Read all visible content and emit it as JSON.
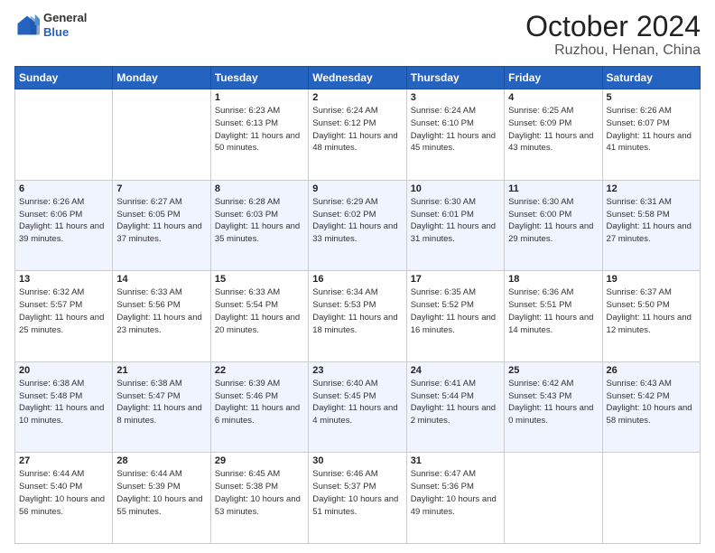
{
  "logo": {
    "general": "General",
    "blue": "Blue"
  },
  "title": "October 2024",
  "subtitle": "Ruzhou, Henan, China",
  "weekdays": [
    "Sunday",
    "Monday",
    "Tuesday",
    "Wednesday",
    "Thursday",
    "Friday",
    "Saturday"
  ],
  "weeks": [
    [
      {
        "day": "",
        "info": ""
      },
      {
        "day": "",
        "info": ""
      },
      {
        "day": "1",
        "info": "Sunrise: 6:23 AM\nSunset: 6:13 PM\nDaylight: 11 hours and 50 minutes."
      },
      {
        "day": "2",
        "info": "Sunrise: 6:24 AM\nSunset: 6:12 PM\nDaylight: 11 hours and 48 minutes."
      },
      {
        "day": "3",
        "info": "Sunrise: 6:24 AM\nSunset: 6:10 PM\nDaylight: 11 hours and 45 minutes."
      },
      {
        "day": "4",
        "info": "Sunrise: 6:25 AM\nSunset: 6:09 PM\nDaylight: 11 hours and 43 minutes."
      },
      {
        "day": "5",
        "info": "Sunrise: 6:26 AM\nSunset: 6:07 PM\nDaylight: 11 hours and 41 minutes."
      }
    ],
    [
      {
        "day": "6",
        "info": "Sunrise: 6:26 AM\nSunset: 6:06 PM\nDaylight: 11 hours and 39 minutes."
      },
      {
        "day": "7",
        "info": "Sunrise: 6:27 AM\nSunset: 6:05 PM\nDaylight: 11 hours and 37 minutes."
      },
      {
        "day": "8",
        "info": "Sunrise: 6:28 AM\nSunset: 6:03 PM\nDaylight: 11 hours and 35 minutes."
      },
      {
        "day": "9",
        "info": "Sunrise: 6:29 AM\nSunset: 6:02 PM\nDaylight: 11 hours and 33 minutes."
      },
      {
        "day": "10",
        "info": "Sunrise: 6:30 AM\nSunset: 6:01 PM\nDaylight: 11 hours and 31 minutes."
      },
      {
        "day": "11",
        "info": "Sunrise: 6:30 AM\nSunset: 6:00 PM\nDaylight: 11 hours and 29 minutes."
      },
      {
        "day": "12",
        "info": "Sunrise: 6:31 AM\nSunset: 5:58 PM\nDaylight: 11 hours and 27 minutes."
      }
    ],
    [
      {
        "day": "13",
        "info": "Sunrise: 6:32 AM\nSunset: 5:57 PM\nDaylight: 11 hours and 25 minutes."
      },
      {
        "day": "14",
        "info": "Sunrise: 6:33 AM\nSunset: 5:56 PM\nDaylight: 11 hours and 23 minutes."
      },
      {
        "day": "15",
        "info": "Sunrise: 6:33 AM\nSunset: 5:54 PM\nDaylight: 11 hours and 20 minutes."
      },
      {
        "day": "16",
        "info": "Sunrise: 6:34 AM\nSunset: 5:53 PM\nDaylight: 11 hours and 18 minutes."
      },
      {
        "day": "17",
        "info": "Sunrise: 6:35 AM\nSunset: 5:52 PM\nDaylight: 11 hours and 16 minutes."
      },
      {
        "day": "18",
        "info": "Sunrise: 6:36 AM\nSunset: 5:51 PM\nDaylight: 11 hours and 14 minutes."
      },
      {
        "day": "19",
        "info": "Sunrise: 6:37 AM\nSunset: 5:50 PM\nDaylight: 11 hours and 12 minutes."
      }
    ],
    [
      {
        "day": "20",
        "info": "Sunrise: 6:38 AM\nSunset: 5:48 PM\nDaylight: 11 hours and 10 minutes."
      },
      {
        "day": "21",
        "info": "Sunrise: 6:38 AM\nSunset: 5:47 PM\nDaylight: 11 hours and 8 minutes."
      },
      {
        "day": "22",
        "info": "Sunrise: 6:39 AM\nSunset: 5:46 PM\nDaylight: 11 hours and 6 minutes."
      },
      {
        "day": "23",
        "info": "Sunrise: 6:40 AM\nSunset: 5:45 PM\nDaylight: 11 hours and 4 minutes."
      },
      {
        "day": "24",
        "info": "Sunrise: 6:41 AM\nSunset: 5:44 PM\nDaylight: 11 hours and 2 minutes."
      },
      {
        "day": "25",
        "info": "Sunrise: 6:42 AM\nSunset: 5:43 PM\nDaylight: 11 hours and 0 minutes."
      },
      {
        "day": "26",
        "info": "Sunrise: 6:43 AM\nSunset: 5:42 PM\nDaylight: 10 hours and 58 minutes."
      }
    ],
    [
      {
        "day": "27",
        "info": "Sunrise: 6:44 AM\nSunset: 5:40 PM\nDaylight: 10 hours and 56 minutes."
      },
      {
        "day": "28",
        "info": "Sunrise: 6:44 AM\nSunset: 5:39 PM\nDaylight: 10 hours and 55 minutes."
      },
      {
        "day": "29",
        "info": "Sunrise: 6:45 AM\nSunset: 5:38 PM\nDaylight: 10 hours and 53 minutes."
      },
      {
        "day": "30",
        "info": "Sunrise: 6:46 AM\nSunset: 5:37 PM\nDaylight: 10 hours and 51 minutes."
      },
      {
        "day": "31",
        "info": "Sunrise: 6:47 AM\nSunset: 5:36 PM\nDaylight: 10 hours and 49 minutes."
      },
      {
        "day": "",
        "info": ""
      },
      {
        "day": "",
        "info": ""
      }
    ]
  ]
}
